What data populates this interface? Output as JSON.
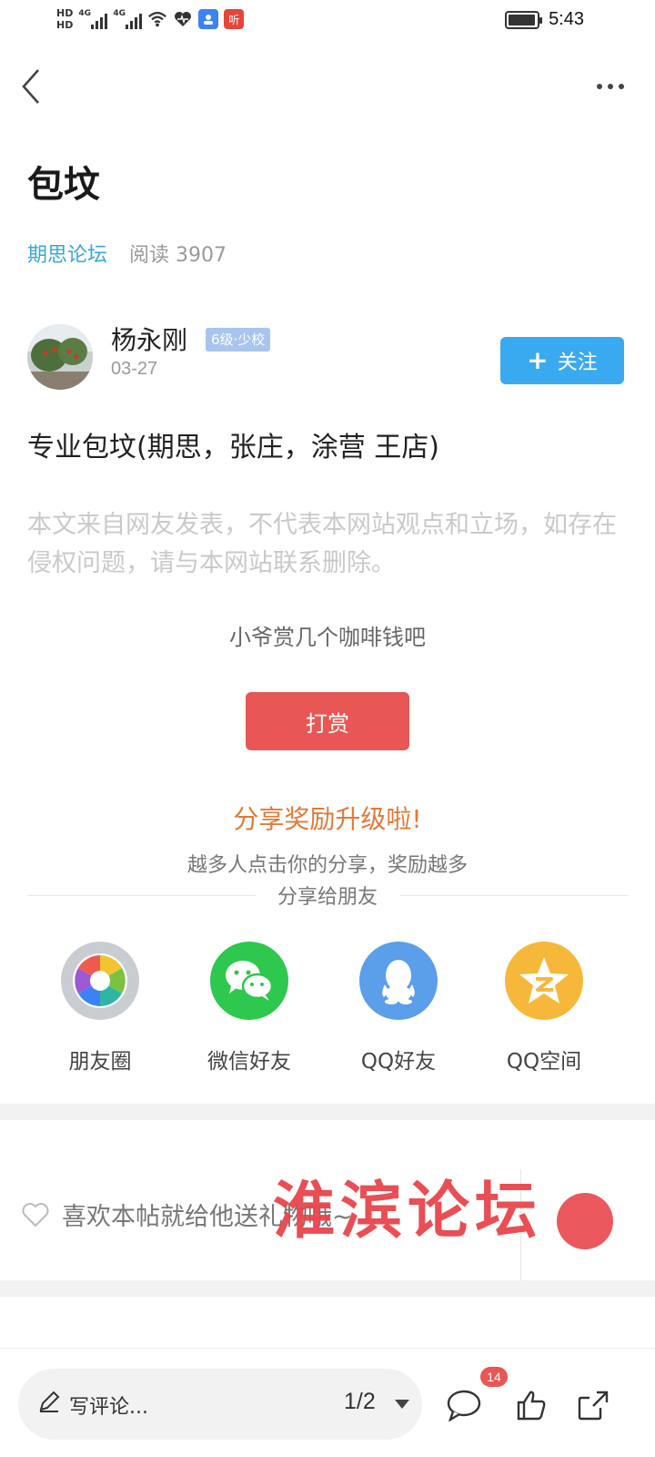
{
  "status_bar": {
    "time": "5:43",
    "hd1": "HD",
    "hd2": "HD",
    "net1": "4G",
    "net2": "4G",
    "app_badge_2": "听",
    "battery_level": 0.95
  },
  "nav": {
    "back_icon": "chevron-left-icon",
    "more_icon": "more-horizontal-icon"
  },
  "post": {
    "title": "包坟",
    "forum": "期思论坛",
    "read_label": "阅读 3907",
    "author_name": "杨永刚",
    "level": "6级·少校",
    "date": "03-27",
    "follow_label": "关注",
    "body": "专业包坟(期思，张庄，涂营  王店)",
    "disclaimer": "本文来自网友发表，不代表本网站观点和立场，如存在侵权问题，请与本网站联系删除。"
  },
  "tip": {
    "text": "小爷赏几个咖啡钱吧",
    "button": "打赏"
  },
  "share": {
    "title": "分享奖励升级啦!",
    "subtitle": "越多人点击你的分享，奖励越多",
    "divider_label": "分享给朋友",
    "items": [
      {
        "label": "朋友圈",
        "icon": "moments-icon",
        "color": "#c9ccd1"
      },
      {
        "label": "微信好友",
        "icon": "wechat-icon",
        "color": "#2dc84d"
      },
      {
        "label": "QQ好友",
        "icon": "qq-icon",
        "color": "#5b9ee9"
      },
      {
        "label": "QQ空间",
        "icon": "qzone-icon",
        "color": "#f6b83a"
      }
    ]
  },
  "like": {
    "text": "喜欢本帖就给他送礼物哦~"
  },
  "watermark": {
    "text": "淮滨论坛"
  },
  "bottom_bar": {
    "comment_placeholder": "写评论...",
    "page": "1/2",
    "comment_count": "14"
  },
  "colors": {
    "accent_blue": "#3aaaf0",
    "forum_link": "#3aa6d8",
    "tip_red": "#e85655",
    "share_orange": "#e07a3a"
  }
}
